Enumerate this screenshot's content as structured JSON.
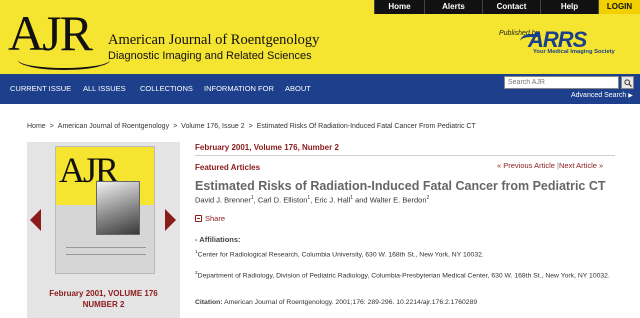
{
  "top_nav": [
    {
      "label": "Home",
      "w": 50
    },
    {
      "label": "Alerts",
      "w": 58
    },
    {
      "label": "Contact",
      "w": 58
    },
    {
      "label": "Help",
      "w": 58
    },
    {
      "label": "LOGIN",
      "w": 42
    }
  ],
  "header": {
    "logo": "AJR",
    "journal_title": "American Journal of Roentgenology",
    "journal_subtitle": "Diagnostic Imaging and Related Sciences",
    "published_by": "Published by",
    "publisher_logo": "ARRS",
    "publisher_tagline": "Your Medical Imaging Society"
  },
  "main_nav": [
    "CURRENT ISSUE",
    "ALL ISSUES",
    "COLLECTIONS",
    "INFORMATION FOR",
    "ABOUT"
  ],
  "search": {
    "placeholder": "Search AJR",
    "advanced_label": "Advanced Search"
  },
  "breadcrumb": [
    "Home",
    "American Journal of Roentgenology",
    "Volume 176, Issue 2",
    "Estimated Risks Of Radiation-Induced Fatal Cancer From Pediatric CT"
  ],
  "cover": {
    "logo": "AJR",
    "issue_line1": "February 2001, VOLUME 176",
    "issue_line2": "NUMBER 2"
  },
  "article": {
    "issue_date": "February 2001, Volume 176, Number 2",
    "type": "Featured Articles",
    "prev_label": "« Previous Article",
    "separator": "|",
    "next_label": "Next Article »",
    "title": "Estimated Risks of Radiation-Induced Fatal Cancer from Pediatric CT",
    "authors": [
      {
        "name": "David J. Brenner",
        "sup": "1"
      },
      {
        "name": "Carl D. Elliston",
        "sup": "1"
      },
      {
        "name": "Eric J. Hall",
        "sup": "1"
      },
      {
        "name": "Walter E. Berdon",
        "sup": "2"
      }
    ],
    "share_label": "Share",
    "affiliations_heading": "- Affiliations:",
    "affiliations": [
      {
        "sup": "1",
        "text": "Center for Radiological Research, Columbia University, 630 W. 168th St., New York, NY 10032."
      },
      {
        "sup": "2",
        "text": "Department of Radiology, Division of Pediatric Radiology, Columbia-Presbyterian Medical Center, 630 W. 168th St., New York, NY 10032."
      }
    ],
    "citation_label": "Citation:",
    "citation_text": "American Journal of Roentgenology. 2001;176: 289-296. 10.2214/ajr.176.2.1760289"
  },
  "colors": {
    "header_yellow": "#f5e430",
    "nav_blue": "#1d3f8c",
    "accent_red": "#8b1a1a"
  }
}
